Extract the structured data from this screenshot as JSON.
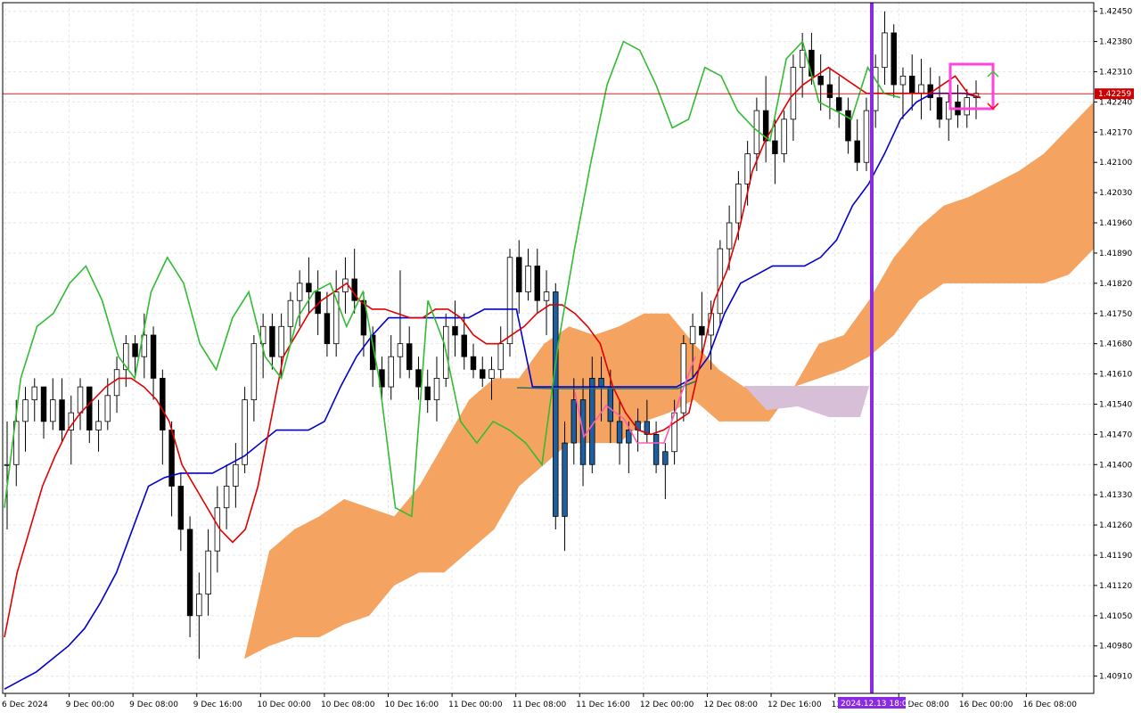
{
  "chart_data": {
    "type": "candlestick",
    "title": "",
    "ylim": [
      1.4087,
      1.4247
    ],
    "y_ticks": [
      "1.42450",
      "1.42380",
      "1.42310",
      "1.42240",
      "1.42170",
      "1.42100",
      "1.42030",
      "1.41960",
      "1.41890",
      "1.41820",
      "1.41750",
      "1.41680",
      "1.41610",
      "1.41540",
      "1.41470",
      "1.41400",
      "1.41330",
      "1.41260",
      "1.41190",
      "1.41120",
      "1.41050",
      "1.40980",
      "1.40910"
    ],
    "x_ticks": [
      "6 Dec 2024",
      "9 Dec 00:00",
      "9 Dec 08:00",
      "9 Dec 16:00",
      "10 Dec 00:00",
      "10 Dec 08:00",
      "10 Dec 16:00",
      "11 Dec 00:00",
      "11 Dec 08:00",
      "11 Dec 16:00",
      "12 Dec 00:00",
      "12 Dec 08:00",
      "12 Dec 16:00",
      "13 Dec 00:00",
      "13 Dec 08:00",
      "16 Dec 00:00",
      "16 Dec 08:00"
    ],
    "cursor_time_label": "2024.12.13 18:00",
    "current_price": "1.42259",
    "grid": true,
    "colors": {
      "tenkan": "#e00000",
      "kijun": "#0000cc",
      "chikou": "#33bb33",
      "cloud_bull": "#f4a460",
      "cloud_bear": "#d8bfd8",
      "price_line": "#cc0000",
      "vertical_line": "#8a2be2",
      "highlight": "#ff44dd",
      "highlight_line": "#ff5bb5",
      "dark_line": "#2f6f5f"
    },
    "candles": [
      [
        1.414,
        1.415,
        1.4125,
        1.414
      ],
      [
        1.414,
        1.4155,
        1.4135,
        1.415
      ],
      [
        1.415,
        1.4158,
        1.4143,
        1.4155
      ],
      [
        1.4155,
        1.416,
        1.415,
        1.4158
      ],
      [
        1.4158,
        1.4157,
        1.4146,
        1.415
      ],
      [
        1.415,
        1.416,
        1.4148,
        1.4155
      ],
      [
        1.4155,
        1.416,
        1.4145,
        1.4148
      ],
      [
        1.4148,
        1.4156,
        1.414,
        1.4152
      ],
      [
        1.4152,
        1.416,
        1.4148,
        1.4158
      ],
      [
        1.4158,
        1.4156,
        1.4145,
        1.4148
      ],
      [
        1.4148,
        1.4155,
        1.4143,
        1.415
      ],
      [
        1.415,
        1.416,
        1.4148,
        1.4156
      ],
      [
        1.4156,
        1.4165,
        1.4152,
        1.4162
      ],
      [
        1.4162,
        1.417,
        1.4158,
        1.4168
      ],
      [
        1.4168,
        1.417,
        1.416,
        1.4165
      ],
      [
        1.4165,
        1.4175,
        1.416,
        1.417
      ],
      [
        1.417,
        1.4172,
        1.4155,
        1.416
      ],
      [
        1.416,
        1.4162,
        1.414,
        1.4148
      ],
      [
        1.4148,
        1.415,
        1.4128,
        1.4135
      ],
      [
        1.4135,
        1.4138,
        1.412,
        1.4125
      ],
      [
        1.4125,
        1.4128,
        1.41,
        1.4105
      ],
      [
        1.4105,
        1.4115,
        1.4095,
        1.411
      ],
      [
        1.411,
        1.4125,
        1.4105,
        1.412
      ],
      [
        1.412,
        1.4135,
        1.4115,
        1.413
      ],
      [
        1.413,
        1.414,
        1.4125,
        1.4135
      ],
      [
        1.4135,
        1.4145,
        1.413,
        1.414
      ],
      [
        1.414,
        1.4158,
        1.4138,
        1.4155
      ],
      [
        1.4155,
        1.417,
        1.415,
        1.4168
      ],
      [
        1.4168,
        1.4175,
        1.416,
        1.4172
      ],
      [
        1.4172,
        1.4175,
        1.4162,
        1.4165
      ],
      [
        1.4165,
        1.4175,
        1.416,
        1.4172
      ],
      [
        1.4172,
        1.418,
        1.4168,
        1.4178
      ],
      [
        1.4178,
        1.4185,
        1.4172,
        1.4182
      ],
      [
        1.4182,
        1.4188,
        1.4175,
        1.418
      ],
      [
        1.418,
        1.4185,
        1.417,
        1.4175
      ],
      [
        1.4175,
        1.418,
        1.4165,
        1.4168
      ],
      [
        1.4168,
        1.4185,
        1.4165,
        1.418
      ],
      [
        1.418,
        1.4188,
        1.4175,
        1.4183
      ],
      [
        1.4183,
        1.419,
        1.4175,
        1.4178
      ],
      [
        1.4178,
        1.418,
        1.4165,
        1.417
      ],
      [
        1.417,
        1.4172,
        1.4158,
        1.4162
      ],
      [
        1.4162,
        1.4165,
        1.4155,
        1.4158
      ],
      [
        1.4158,
        1.417,
        1.4155,
        1.4165
      ],
      [
        1.4165,
        1.4185,
        1.416,
        1.4168
      ],
      [
        1.4168,
        1.4172,
        1.416,
        1.4162
      ],
      [
        1.4162,
        1.4165,
        1.4155,
        1.4158
      ],
      [
        1.4158,
        1.4162,
        1.4152,
        1.4155
      ],
      [
        1.4155,
        1.4165,
        1.415,
        1.416
      ],
      [
        1.416,
        1.4175,
        1.4158,
        1.4172
      ],
      [
        1.4172,
        1.4178,
        1.4165,
        1.417
      ],
      [
        1.417,
        1.4175,
        1.4162,
        1.4165
      ],
      [
        1.4165,
        1.4168,
        1.416,
        1.4162
      ],
      [
        1.4162,
        1.4165,
        1.4158,
        1.416
      ],
      [
        1.416,
        1.4165,
        1.4155,
        1.4162
      ],
      [
        1.4162,
        1.4172,
        1.416,
        1.4168
      ],
      [
        1.4168,
        1.419,
        1.4165,
        1.4188
      ],
      [
        1.4188,
        1.4192,
        1.4175,
        1.418
      ],
      [
        1.418,
        1.419,
        1.4178,
        1.4186
      ],
      [
        1.4186,
        1.419,
        1.4175,
        1.4178
      ],
      [
        1.4178,
        1.4185,
        1.417,
        1.418
      ],
      [
        1.418,
        1.4182,
        1.4125,
        1.4128
      ],
      [
        1.4128,
        1.415,
        1.412,
        1.4145
      ],
      [
        1.4145,
        1.416,
        1.414,
        1.4155
      ],
      [
        1.4155,
        1.416,
        1.4135,
        1.414
      ],
      [
        1.414,
        1.4165,
        1.4138,
        1.416
      ],
      [
        1.416,
        1.4165,
        1.415,
        1.4158
      ],
      [
        1.4158,
        1.4162,
        1.4145,
        1.415
      ],
      [
        1.415,
        1.4155,
        1.414,
        1.4145
      ],
      [
        1.4145,
        1.415,
        1.4138,
        1.4148
      ],
      [
        1.4148,
        1.4153,
        1.4143,
        1.415
      ],
      [
        1.415,
        1.4155,
        1.4145,
        1.4147
      ],
      [
        1.4147,
        1.415,
        1.4138,
        1.414
      ],
      [
        1.414,
        1.4145,
        1.4132,
        1.4143
      ],
      [
        1.4143,
        1.4155,
        1.414,
        1.4152
      ],
      [
        1.4152,
        1.417,
        1.415,
        1.4168
      ],
      [
        1.4168,
        1.4175,
        1.416,
        1.4172
      ],
      [
        1.4172,
        1.418,
        1.4165,
        1.417
      ],
      [
        1.417,
        1.4178,
        1.4162,
        1.4175
      ],
      [
        1.4175,
        1.4192,
        1.4172,
        1.419
      ],
      [
        1.419,
        1.42,
        1.4185,
        1.4196
      ],
      [
        1.4196,
        1.4208,
        1.4192,
        1.4205
      ],
      [
        1.4205,
        1.4215,
        1.42,
        1.4212
      ],
      [
        1.4212,
        1.4225,
        1.4208,
        1.4222
      ],
      [
        1.4222,
        1.423,
        1.421,
        1.4215
      ],
      [
        1.4215,
        1.422,
        1.4205,
        1.4212
      ],
      [
        1.4212,
        1.4222,
        1.421,
        1.422
      ],
      [
        1.422,
        1.4235,
        1.4215,
        1.4232
      ],
      [
        1.4232,
        1.424,
        1.4225,
        1.4236
      ],
      [
        1.4236,
        1.424,
        1.4228,
        1.423
      ],
      [
        1.423,
        1.4235,
        1.4222,
        1.4228
      ],
      [
        1.4228,
        1.4232,
        1.422,
        1.4225
      ],
      [
        1.4225,
        1.423,
        1.4218,
        1.4222
      ],
      [
        1.4222,
        1.4225,
        1.4212,
        1.4215
      ],
      [
        1.4215,
        1.422,
        1.4208,
        1.421
      ],
      [
        1.421,
        1.4225,
        1.4208,
        1.4222
      ],
      [
        1.4222,
        1.4235,
        1.4218,
        1.4232
      ],
      [
        1.4232,
        1.4245,
        1.4228,
        1.424
      ],
      [
        1.424,
        1.4242,
        1.4225,
        1.4228
      ],
      [
        1.4228,
        1.4232,
        1.422,
        1.423
      ],
      [
        1.423,
        1.4235,
        1.4222,
        1.4226
      ],
      [
        1.4226,
        1.4234,
        1.422,
        1.4228
      ],
      [
        1.4228,
        1.4232,
        1.4222,
        1.4225
      ],
      [
        1.4225,
        1.423,
        1.4218,
        1.422
      ],
      [
        1.422,
        1.4226,
        1.4215,
        1.4224
      ],
      [
        1.4224,
        1.4228,
        1.4218,
        1.4221
      ],
      [
        1.4221,
        1.4227,
        1.4218,
        1.4225
      ],
      [
        1.4225,
        1.4229,
        1.422,
        1.4226
      ]
    ],
    "tenkan": [
      1.41,
      1.4115,
      1.4125,
      1.4135,
      1.4142,
      1.4148,
      1.4152,
      1.4155,
      1.4158,
      1.416,
      1.416,
      1.4158,
      1.4155,
      1.415,
      1.414,
      1.4135,
      1.413,
      1.4125,
      1.4122,
      1.4125,
      1.4135,
      1.415,
      1.4165,
      1.417,
      1.4175,
      1.4178,
      1.418,
      1.4182,
      1.4178,
      1.4176,
      1.4176,
      1.4175,
      1.4174,
      1.4174,
      1.4176,
      1.4176,
      1.4174,
      1.417,
      1.4168,
      1.4168,
      1.417,
      1.4172,
      1.4175,
      1.4177,
      1.4177,
      1.4175,
      1.4172,
      1.4168,
      1.4158,
      1.4152,
      1.4148,
      1.4147,
      1.4148,
      1.415,
      1.4152,
      1.4165,
      1.4178,
      1.4185,
      1.4195,
      1.4208,
      1.4215,
      1.422,
      1.4225,
      1.4228,
      1.423,
      1.4232,
      1.423,
      1.4228,
      1.4226,
      1.4226,
      1.4226,
      1.4226,
      1.4226,
      1.4226,
      1.4228,
      1.423,
      1.4226,
      1.4225
    ],
    "kijun": [
      1.4088,
      1.409,
      1.4092,
      1.4095,
      1.4098,
      1.4102,
      1.4108,
      1.4115,
      1.4125,
      1.4135,
      1.4137,
      1.4138,
      1.4138,
      1.4138,
      1.414,
      1.4142,
      1.4145,
      1.4148,
      1.4148,
      1.4148,
      1.415,
      1.4158,
      1.4165,
      1.417,
      1.4174,
      1.4174,
      1.4174,
      1.4174,
      1.4174,
      1.4174,
      1.4176,
      1.4176,
      1.4176,
      1.4158,
      1.4158,
      1.4158,
      1.4158,
      1.4158,
      1.4158,
      1.4158,
      1.4158,
      1.4158,
      1.4158,
      1.416,
      1.4165,
      1.4175,
      1.4182,
      1.4184,
      1.4186,
      1.4186,
      1.4186,
      1.4188,
      1.4192,
      1.42,
      1.4205,
      1.4212,
      1.422,
      1.4224,
      1.4226,
      1.4226,
      1.4226,
      1.4225
    ],
    "chikou": [
      1.413,
      1.416,
      1.4172,
      1.4175,
      1.4182,
      1.4186,
      1.4178,
      1.4165,
      1.416,
      1.418,
      1.4188,
      1.4182,
      1.4168,
      1.4162,
      1.4174,
      1.418,
      1.4165,
      1.416,
      1.4174,
      1.418,
      1.4182,
      1.4172,
      1.418,
      1.416,
      1.413,
      1.4128,
      1.4178,
      1.4168,
      1.415,
      1.4145,
      1.415,
      1.4148,
      1.4145,
      1.414,
      1.4168,
      1.419,
      1.421,
      1.4228,
      1.4238,
      1.4236,
      1.4228,
      1.4218,
      1.422,
      1.4232,
      1.423,
      1.4222,
      1.4218,
      1.4215,
      1.4234,
      1.4238,
      1.4224,
      1.4222,
      1.422,
      1.4232,
      1.4226,
      1.4225
    ],
    "cloud_upper": [
      1.4087,
      1.409,
      1.4095,
      1.412,
      1.4125,
      1.4128,
      1.4132,
      1.413,
      1.4128,
      1.4135,
      1.4145,
      1.4155,
      1.416,
      1.416,
      1.4168,
      1.4172,
      1.417,
      1.4172,
      1.4175,
      1.4175,
      1.4168,
      1.4162,
      1.4158,
      1.4158,
      1.4158,
      1.4168,
      1.417,
      1.4178,
      1.4188,
      1.4195,
      1.42,
      1.4202,
      1.4205,
      1.4208,
      1.4212,
      1.4218,
      1.4224
    ],
    "cloud_lower": [
      1.4087,
      1.409,
      1.4095,
      1.4098,
      1.41,
      1.41,
      1.4103,
      1.4105,
      1.4112,
      1.4115,
      1.4115,
      1.412,
      1.4125,
      1.4135,
      1.414,
      1.4145,
      1.4145,
      1.4145,
      1.415,
      1.4152,
      1.4155,
      1.415,
      1.415,
      1.415,
      1.4158,
      1.416,
      1.4162,
      1.4165,
      1.417,
      1.4178,
      1.4182,
      1.4182,
      1.4182,
      1.4182,
      1.4182,
      1.4184,
      1.419
    ]
  }
}
